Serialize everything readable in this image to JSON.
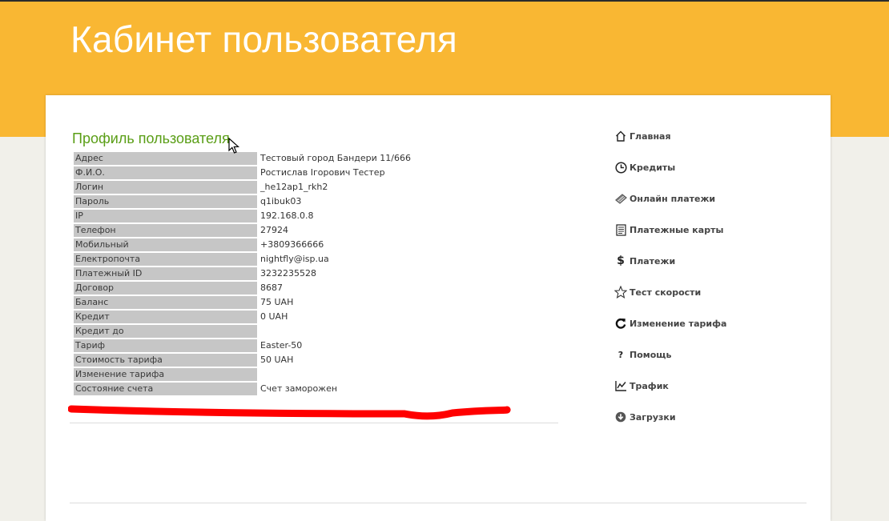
{
  "header": {
    "title": "Кабинет пользователя"
  },
  "profile": {
    "title": "Профиль пользователя",
    "rows": [
      {
        "label": "Адрес",
        "value": "Тестовый город Бандери 11/666"
      },
      {
        "label": "Ф.И.О.",
        "value": "Ростислав Ігорович Тестер"
      },
      {
        "label": "Логин",
        "value": "_he12ap1_rkh2"
      },
      {
        "label": "Пароль",
        "value": "q1ibuk03"
      },
      {
        "label": "IP",
        "value": "192.168.0.8"
      },
      {
        "label": "Телефон",
        "value": "27924"
      },
      {
        "label": "Мобильный",
        "value": "+3809366666"
      },
      {
        "label": "Електропочта",
        "value": "nightfly@isp.ua"
      },
      {
        "label": "Платежный ID",
        "value": "3232235528"
      },
      {
        "label": "Договор",
        "value": "8687"
      },
      {
        "label": "Баланс",
        "value": "75 UAH"
      },
      {
        "label": "Кредит",
        "value": "0 UAH"
      },
      {
        "label": "Кредит до",
        "value": ""
      },
      {
        "label": "Тариф",
        "value": "Easter-50"
      },
      {
        "label": "Стоимость тарифа",
        "value": "50 UAH"
      },
      {
        "label": "Изменение тарифа",
        "value": ""
      },
      {
        "label": "Состояние счета",
        "value": "Счет заморожен"
      }
    ]
  },
  "menu": {
    "items": [
      {
        "label": "Главная",
        "icon": "home-icon"
      },
      {
        "label": "Кредиты",
        "icon": "clock-icon"
      },
      {
        "label": "Онлайн платежи",
        "icon": "card-icon"
      },
      {
        "label": "Платежные карты",
        "icon": "document-icon"
      },
      {
        "label": "Платежи",
        "icon": "dollar-icon"
      },
      {
        "label": "Тест скорости",
        "icon": "star-icon"
      },
      {
        "label": "Изменение тарифа",
        "icon": "refresh-icon"
      },
      {
        "label": "Помощь",
        "icon": "question-icon"
      },
      {
        "label": "Трафик",
        "icon": "chart-icon"
      },
      {
        "label": "Загрузки",
        "icon": "download-icon"
      }
    ]
  },
  "colors": {
    "header_bg": "#f9b733",
    "title_green": "#5a9e16",
    "label_bg": "#c6c6c6",
    "redaction": "#ff0000"
  }
}
